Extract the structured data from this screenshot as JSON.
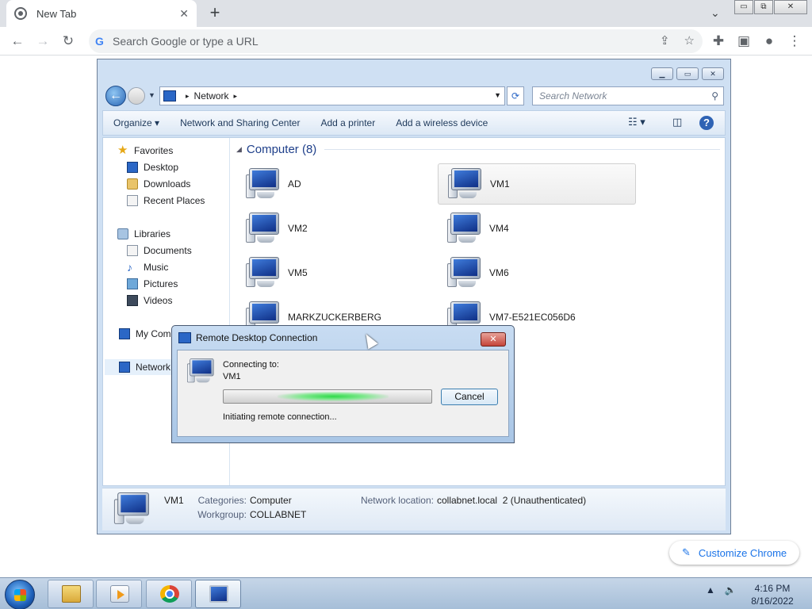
{
  "browser": {
    "tab_title": "New Tab",
    "tab_close": "✕",
    "new_tab": "+",
    "tab_search": "⌄",
    "omnibox_placeholder": "Search Google or type a URL",
    "window_controls": [
      "▭",
      "⧉",
      "✕"
    ],
    "customize_label": "Customize Chrome",
    "icons": [
      "back-icon",
      "forward-icon",
      "reload-icon",
      "google-icon",
      "share-icon",
      "star-icon",
      "extensions-icon",
      "side-panel-icon",
      "profile-icon",
      "menu-icon"
    ]
  },
  "explorer": {
    "address_path": [
      "Network"
    ],
    "search_placeholder": "Search Network",
    "commands": [
      "Organize ▾",
      "Network and Sharing Center",
      "Add a printer",
      "Add a wireless device"
    ],
    "nav": {
      "favorites": "Favorites",
      "favorite_items": [
        "Desktop",
        "Downloads",
        "Recent Places"
      ],
      "libraries": "Libraries",
      "library_items": [
        "Documents",
        "Music",
        "Pictures",
        "Videos"
      ],
      "my_computer": "My Com",
      "network": "Network"
    },
    "group_title": "Computer (8)",
    "computers": [
      "AD",
      "VM1",
      "VM2",
      "VM4",
      "VM5",
      "VM6",
      "MARKZUCKERBERG",
      "VM7-E521EC056D6"
    ],
    "selected_computer": "VM1",
    "details": {
      "name": "VM1",
      "categories_label": "Categories:",
      "categories_value": "Computer",
      "workgroup_label": "Workgroup:",
      "workgroup_value": "COLLABNET",
      "network_location_label": "Network location:",
      "network_location_value": "collabnet.local  2 (Unauthenticated)"
    }
  },
  "rdc_dialog": {
    "title": "Remote Desktop Connection",
    "connecting_to_label": "Connecting to:",
    "target": "VM1",
    "status": "Initiating remote connection...",
    "cancel_label": "Cancel",
    "close_label": "✕",
    "progress_state": "indeterminate"
  },
  "taskbar": {
    "apps": [
      "Windows Explorer",
      "Windows Media Player",
      "Google Chrome",
      "Remote Desktop Connection"
    ],
    "time": "4:16 PM",
    "date": "8/16/2022",
    "tray_icons": [
      "show-hidden-icons",
      "volume-icon"
    ]
  }
}
